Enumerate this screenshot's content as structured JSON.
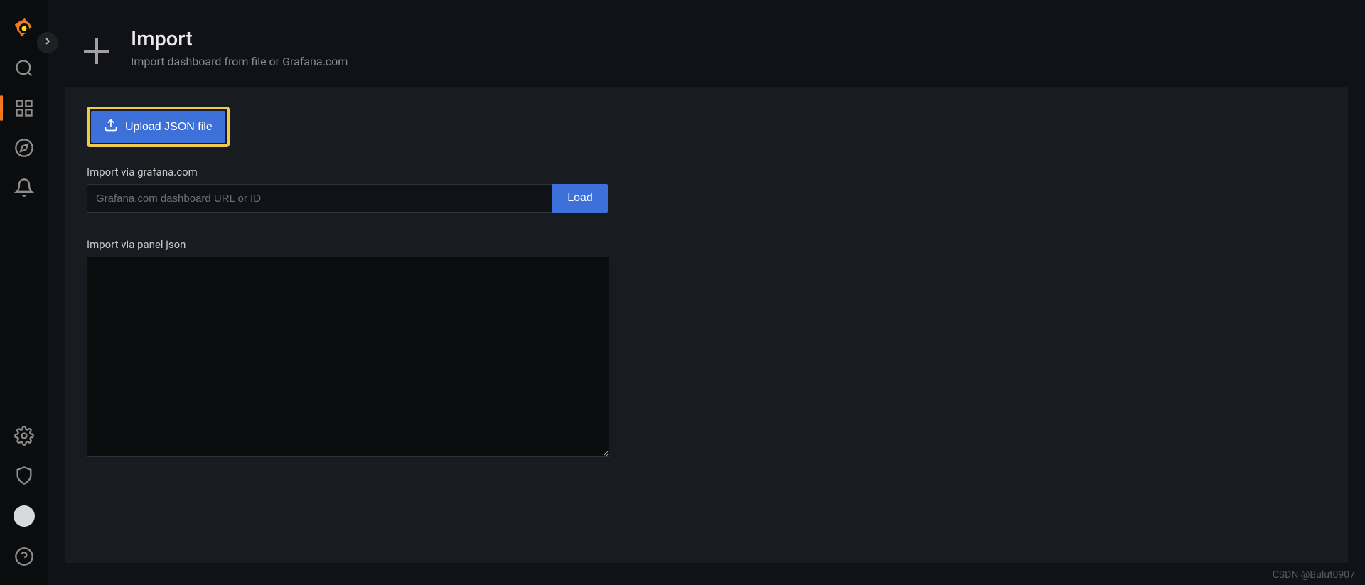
{
  "header": {
    "title": "Import",
    "subtitle": "Import dashboard from file or Grafana.com"
  },
  "upload_button_label": "Upload JSON file",
  "url_section": {
    "label": "Import via grafana.com",
    "placeholder": "Grafana.com dashboard URL or ID",
    "load_label": "Load"
  },
  "json_section": {
    "label": "Import via panel json"
  },
  "watermark": "CSDN @Bulut0907"
}
